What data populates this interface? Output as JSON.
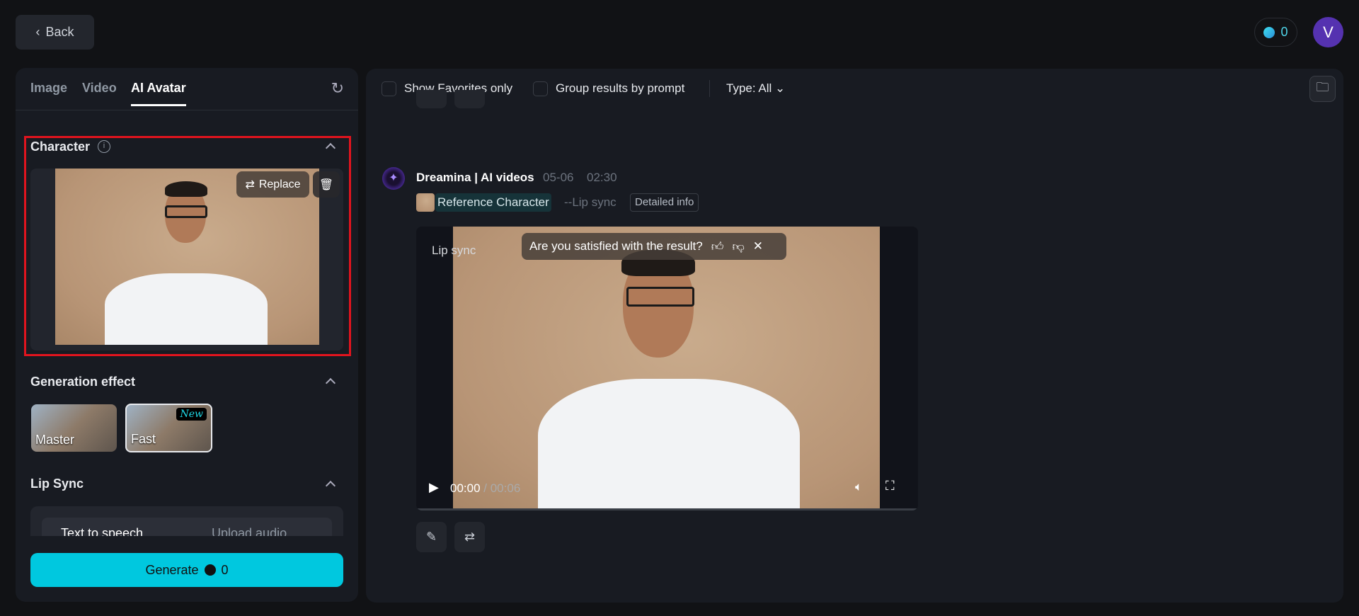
{
  "header": {
    "back_label": "Back",
    "credits": "0",
    "avatar_initial": "V"
  },
  "left_panel": {
    "tabs": [
      {
        "label": "Image"
      },
      {
        "label": "Video"
      },
      {
        "label": "AI Avatar"
      }
    ],
    "character": {
      "title": "Character",
      "replace_label": "Replace"
    },
    "generation_effect": {
      "title": "Generation effect",
      "options": [
        {
          "label": "Master"
        },
        {
          "label": "Fast",
          "badge": "New"
        }
      ]
    },
    "lip_sync": {
      "title": "Lip Sync",
      "modes": [
        {
          "label": "Text to speech"
        },
        {
          "label": "Upload audio"
        }
      ]
    },
    "generate": {
      "label": "Generate",
      "cost": "0"
    }
  },
  "toolbar": {
    "favorites_label": "Show Favorites only",
    "group_label": "Group results by prompt",
    "type_label": "Type: All"
  },
  "result": {
    "source": "Dreamina | AI videos",
    "date": "05-06",
    "time": "02:30",
    "reference_label": "Reference Character",
    "mode": "--Lip sync",
    "detail_label": "Detailed info",
    "video": {
      "label": "Lip sync",
      "feedback": "Are you satisfied with the result?",
      "current": "00:00",
      "duration": "/ 00:06",
      "progress": 0
    }
  },
  "colors": {
    "accent": "#00c8df",
    "avatar": "#5532b0",
    "highlight": "#e0141e"
  }
}
